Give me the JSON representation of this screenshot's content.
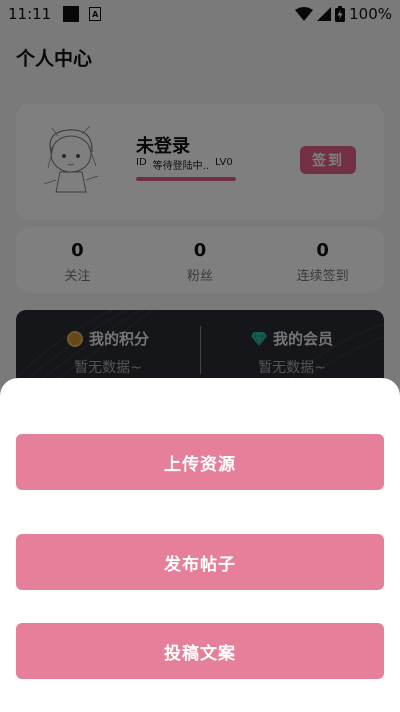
{
  "status_bar": {
    "time": "11:11",
    "battery": "100%"
  },
  "page": {
    "title": "个人中心"
  },
  "profile": {
    "username": "未登录",
    "id_label": "ID",
    "id_value": "等待登陆中..",
    "level": "LV0",
    "level_progress": 1.0,
    "checkin_label": "签到"
  },
  "stats": [
    {
      "value": "0",
      "label": "关注"
    },
    {
      "value": "0",
      "label": "粉丝"
    },
    {
      "value": "0",
      "label": "连续签到"
    }
  ],
  "wallet": {
    "points_title": "我的积分",
    "points_sub": "暂无数据~",
    "vip_title": "我的会员",
    "vip_sub": "暂无数据~"
  },
  "sheet": {
    "buttons": [
      "上传资源",
      "发布帖子",
      "投稿文案"
    ]
  },
  "colors": {
    "accent": "#e46287",
    "sheet_button": "#e57f9a",
    "dark_card": "#2a2d33"
  }
}
